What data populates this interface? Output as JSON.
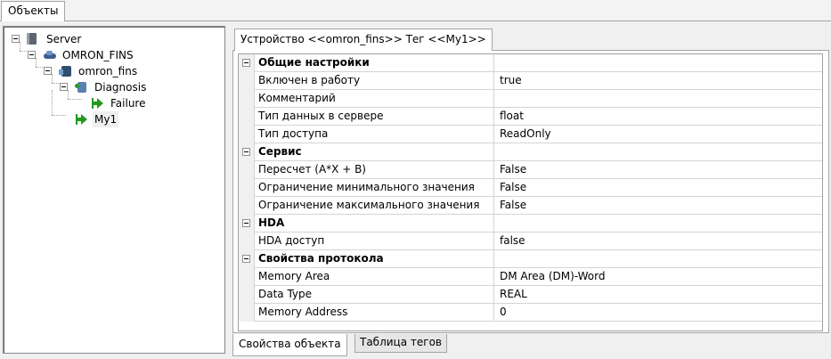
{
  "top_tab": {
    "label": "Объекты"
  },
  "tree": {
    "nodes": [
      {
        "label": "Server",
        "icon": "server-icon",
        "expanded": true
      },
      {
        "label": "OMRON_FINS",
        "icon": "driver-icon",
        "expanded": true
      },
      {
        "label": "omron_fins",
        "icon": "device-icon",
        "expanded": true
      },
      {
        "label": "Diagnosis",
        "icon": "diagnosis-icon",
        "expanded": true
      },
      {
        "label": "Failure",
        "icon": "tag-arrow-icon"
      },
      {
        "label": "My1",
        "icon": "tag-arrow-icon",
        "selected": true
      }
    ]
  },
  "props_tab": {
    "label": "Устройство <<omron_fins>> Тег  <<My1>>"
  },
  "grid": {
    "rows": [
      {
        "kind": "category",
        "name": "Общие настройки",
        "value": ""
      },
      {
        "kind": "prop",
        "name": "Включен в работу",
        "value": "true"
      },
      {
        "kind": "prop",
        "name": "Комментарий",
        "value": ""
      },
      {
        "kind": "prop",
        "name": "Тип данных в сервере",
        "value": "float"
      },
      {
        "kind": "prop",
        "name": "Тип доступа",
        "value": "ReadOnly"
      },
      {
        "kind": "category",
        "name": "Сервис",
        "value": ""
      },
      {
        "kind": "prop",
        "name": "Пересчет (A*X + B)",
        "value": "False"
      },
      {
        "kind": "prop",
        "name": "Ограничение минимального значения",
        "value": "False"
      },
      {
        "kind": "prop",
        "name": "Ограничение максимального значения",
        "value": "False"
      },
      {
        "kind": "category",
        "name": "HDA",
        "value": ""
      },
      {
        "kind": "prop",
        "name": "HDA доступ",
        "value": "false"
      },
      {
        "kind": "category",
        "name": "Свойства протокола",
        "value": ""
      },
      {
        "kind": "prop",
        "name": "Memory Area",
        "value": "DM Area (DM)-Word"
      },
      {
        "kind": "prop",
        "name": "Data Type",
        "value": "REAL"
      },
      {
        "kind": "prop",
        "name": "Memory Address",
        "value": "0"
      }
    ]
  },
  "bottom_tabs": {
    "props": "Свойства объекта",
    "tags": "Таблица тегов"
  }
}
